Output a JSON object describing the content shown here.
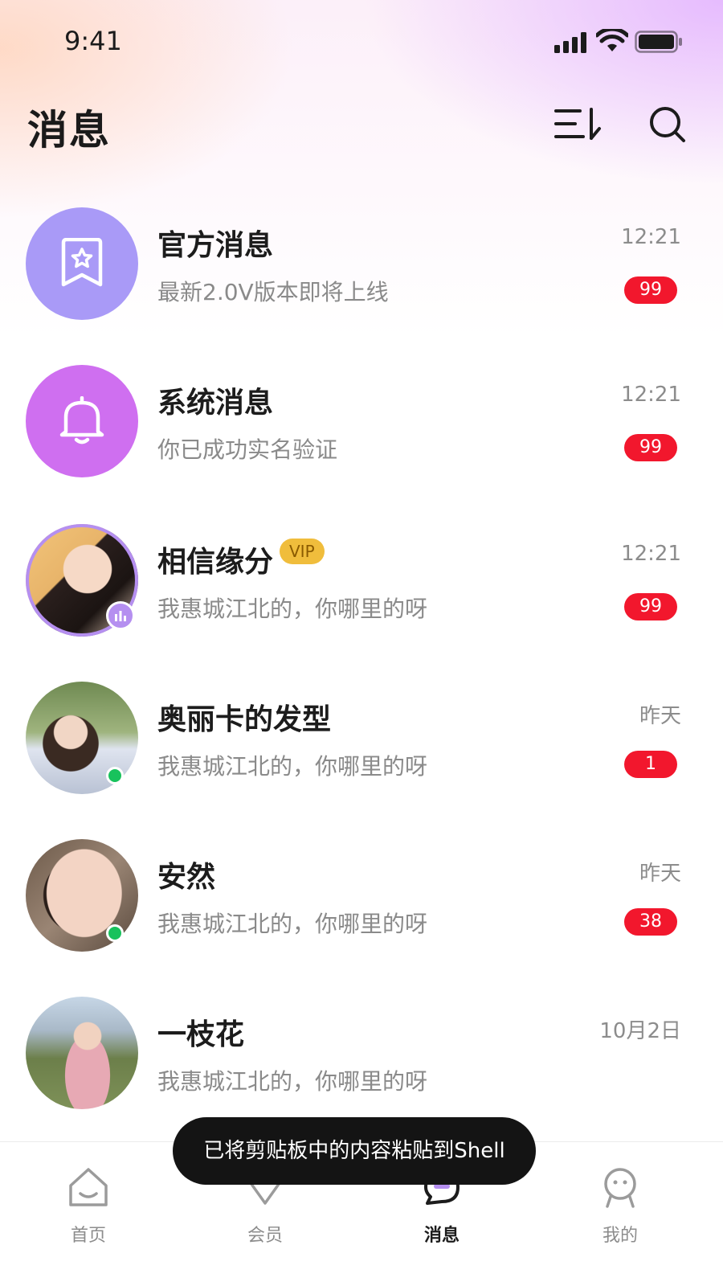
{
  "status_bar": {
    "time": "9:41"
  },
  "header": {
    "title": "消息"
  },
  "conversations": [
    {
      "name": "官方消息",
      "preview": "最新2.0V版本即将上线",
      "time": "12:21",
      "badge": "99",
      "avatar": "official-badge-icon",
      "avatar_color": "#a99af7"
    },
    {
      "name": "系统消息",
      "preview": "你已成功实名验证",
      "time": "12:21",
      "badge": "99",
      "avatar": "bell-icon",
      "avatar_color": "#cf6ff0"
    },
    {
      "name": "相信缘分",
      "vip": "VIP",
      "preview": "我惠城江北的，你哪里的呀",
      "time": "12:21",
      "badge": "99",
      "avatar": "user-photo",
      "status": "live"
    },
    {
      "name": "奥丽卡的发型",
      "preview": "我惠城江北的，你哪里的呀",
      "time": "昨天",
      "badge": "1",
      "avatar": "user-photo",
      "status": "online"
    },
    {
      "name": "安然",
      "preview": "我惠城江北的，你哪里的呀",
      "time": "昨天",
      "badge": "38",
      "avatar": "user-photo",
      "status": "online"
    },
    {
      "name": "一枝花",
      "preview": "我惠城江北的，你哪里的呀",
      "time": "10月2日",
      "avatar": "user-photo"
    }
  ],
  "tabbar": [
    {
      "label": "首页",
      "icon": "home-icon",
      "active": false
    },
    {
      "label": "会员",
      "icon": "member-icon",
      "active": false
    },
    {
      "label": "消息",
      "icon": "message-icon",
      "active": true
    },
    {
      "label": "我的",
      "icon": "profile-icon",
      "active": false
    }
  ],
  "toast": {
    "text": "已将剪贴板中的内容粘贴到Shell"
  },
  "colors": {
    "accent_purple": "#b58ff0",
    "badge_red": "#f2172d",
    "vip_gold": "#f0bd3c",
    "online_green": "#18c25c"
  }
}
